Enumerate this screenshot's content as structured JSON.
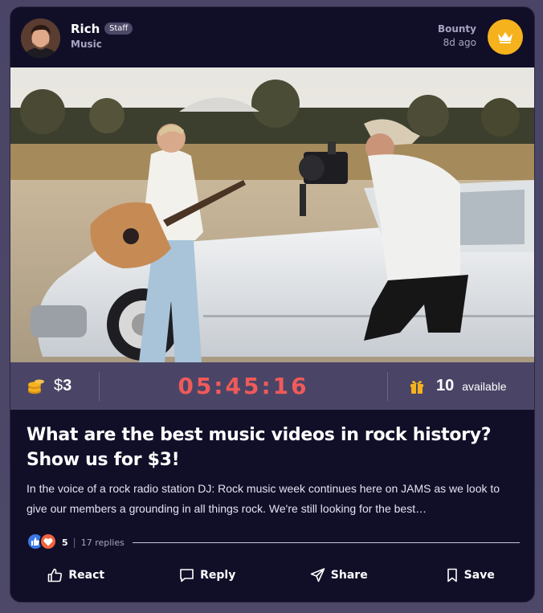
{
  "post": {
    "author": "Rich",
    "badge": "Staff",
    "category": "Music",
    "type_label": "Bounty",
    "time_ago": "8d ago",
    "bounty": {
      "currency_symbol": "$",
      "amount": "3",
      "countdown": "05:45:16",
      "available_count": "10",
      "available_label": "available"
    },
    "title": "What are the best music videos in rock history? Show us for $3!",
    "body": "In the voice of a rock radio station DJ: Rock music week continues here on JAMS as we look to give our members a grounding in all things rock. We're still looking for the best…",
    "reactions": {
      "count": "5",
      "divider": "|",
      "replies": "17 replies"
    },
    "actions": {
      "react": "React",
      "reply": "Reply",
      "share": "Share",
      "save": "Save"
    }
  },
  "colors": {
    "accent_gold": "#f5b21c",
    "timer_red": "#f05a5a",
    "card_bg": "#110f28",
    "stats_bg": "#4a4566"
  }
}
